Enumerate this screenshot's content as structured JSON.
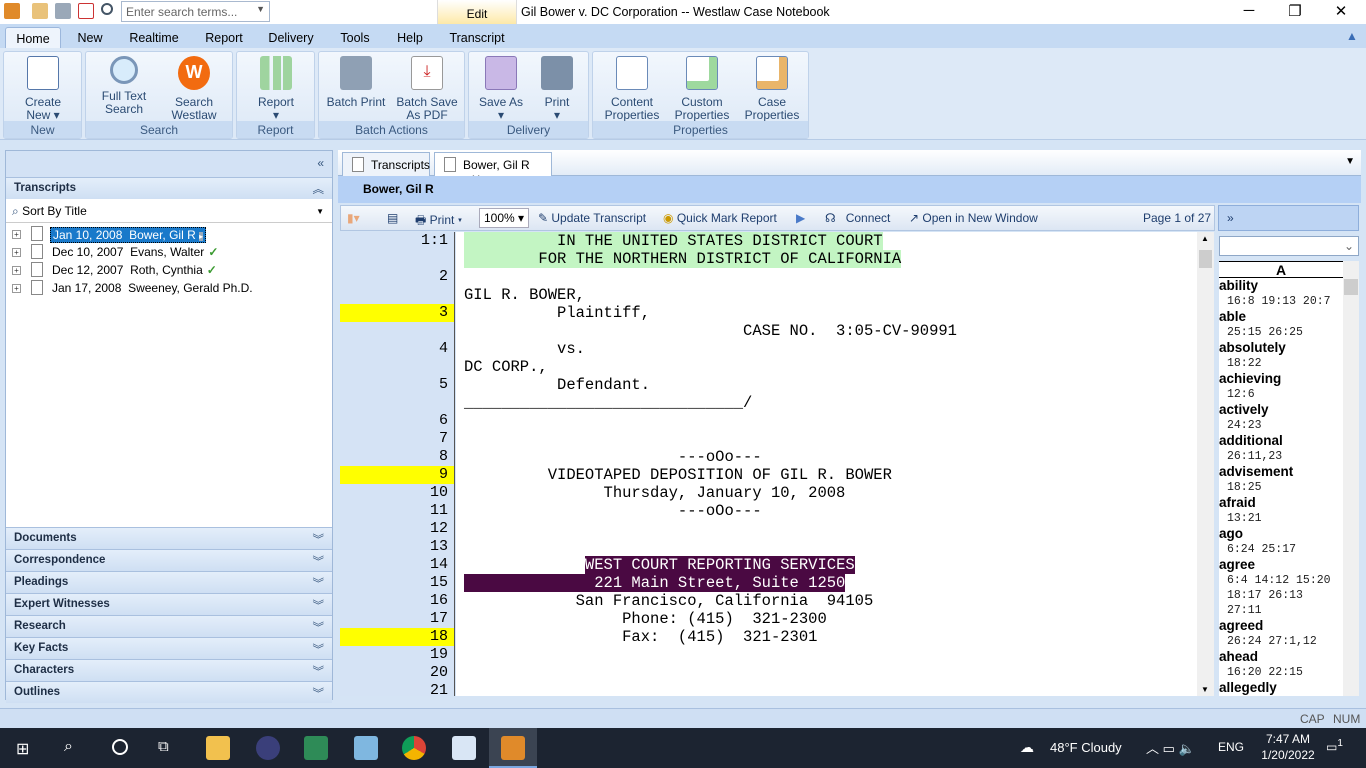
{
  "app": {
    "title": "Gil Bower v. DC Corporation -- Westlaw Case Notebook",
    "search_placeholder": "Enter search terms...",
    "context_tab": "Edit"
  },
  "ribbon_tabs": [
    "Home",
    "New",
    "Realtime",
    "Report",
    "Delivery",
    "Tools",
    "Help",
    "Transcript"
  ],
  "ribbon_groups": [
    {
      "label": "New",
      "buttons": [
        "Create New"
      ]
    },
    {
      "label": "Search",
      "buttons": [
        "Full Text Search",
        "Search Westlaw"
      ]
    },
    {
      "label": "Report",
      "buttons": [
        "Report"
      ]
    },
    {
      "label": "Batch Actions",
      "buttons": [
        "Batch Print",
        "Batch Save As PDF"
      ]
    },
    {
      "label": "Delivery",
      "buttons": [
        "Save As",
        "Print"
      ]
    },
    {
      "label": "Properties",
      "buttons": [
        "Content Properties",
        "Custom Properties",
        "Case Properties"
      ]
    }
  ],
  "left": {
    "section": "Transcripts",
    "sort": "Sort By Title",
    "items": [
      {
        "date": "Jan 10, 2008",
        "name": "Bower, Gil R",
        "checked": false
      },
      {
        "date": "Dec 10, 2007",
        "name": "Evans, Walter",
        "checked": true
      },
      {
        "date": "Dec 12, 2007",
        "name": "Roth, Cynthia",
        "checked": true
      },
      {
        "date": "Jan 17, 2008",
        "name": "Sweeney, Gerald Ph.D.",
        "checked": false
      }
    ],
    "sections": [
      "Documents",
      "Correspondence",
      "Pleadings",
      "Expert Witnesses",
      "Research",
      "Key Facts",
      "Characters",
      "Outlines"
    ]
  },
  "doc_tabs": [
    "Transcripts",
    "Bower, Gil R"
  ],
  "doc_name": "Bower, Gil R",
  "toolbar": {
    "print": "Print",
    "zoom": "100%",
    "update": "Update Transcript",
    "quickmark": "Quick Mark Report",
    "connect": "Connect",
    "open_new": "Open in New Window",
    "page": "Page 1 of 27"
  },
  "transcript": [
    {
      "n": "1:1",
      "t": "          IN THE UNITED STATES DISTRICT COURT",
      "h": "g"
    },
    {
      "n": "",
      "t": "        FOR THE NORTHERN DISTRICT OF CALIFORNIA",
      "h": "g"
    },
    {
      "n": "2",
      "t": ""
    },
    {
      "n": "",
      "t": "GIL R. BOWER,"
    },
    {
      "n": "3",
      "t": "          Plaintiff,",
      "y": true
    },
    {
      "n": "",
      "t": "                              CASE NO.  3:05-CV-90991"
    },
    {
      "n": "4",
      "t": "          vs."
    },
    {
      "n": "",
      "t": "DC CORP.,"
    },
    {
      "n": "5",
      "t": "          Defendant."
    },
    {
      "n": "",
      "t": "______________________________/"
    },
    {
      "n": "6",
      "t": ""
    },
    {
      "n": "7",
      "t": ""
    },
    {
      "n": "8",
      "t": "                       ---oOo---"
    },
    {
      "n": "9",
      "t": "         VIDEOTAPED DEPOSITION OF GIL R. BOWER",
      "y": true
    },
    {
      "n": "10",
      "t": "               Thursday, January 10, 2008"
    },
    {
      "n": "11",
      "t": "                       ---oOo---"
    },
    {
      "n": "12",
      "t": ""
    },
    {
      "n": "13",
      "t": ""
    },
    {
      "n": "14",
      "pre": "             ",
      "t": "WEST COURT REPORTING SERVICES",
      "h": "p"
    },
    {
      "n": "15",
      "t": "              221 Main Street, Suite 1250",
      "h": "p"
    },
    {
      "n": "16",
      "t": "            San Francisco, California  94105"
    },
    {
      "n": "17",
      "t": "                 Phone: (415)  321-2300"
    },
    {
      "n": "18",
      "t": "                 Fax:  (415)  321-2301",
      "y": true
    },
    {
      "n": "19",
      "t": ""
    },
    {
      "n": "20",
      "t": ""
    },
    {
      "n": "21",
      "t": ""
    }
  ],
  "index": {
    "letter": "A",
    "entries": [
      {
        "w": "ability",
        "r": [
          "16:8 19:13 20:7"
        ]
      },
      {
        "w": "able",
        "r": [
          "25:15 26:25"
        ]
      },
      {
        "w": "absolutely",
        "r": [
          "18:22"
        ]
      },
      {
        "w": "achieving",
        "r": [
          "12:6"
        ]
      },
      {
        "w": "actively",
        "r": [
          "24:23"
        ]
      },
      {
        "w": "additional",
        "r": [
          "26:11,23"
        ]
      },
      {
        "w": "advisement",
        "r": [
          "18:25"
        ]
      },
      {
        "w": "afraid",
        "r": [
          "13:21"
        ]
      },
      {
        "w": "ago",
        "r": [
          "6:24 25:17"
        ]
      },
      {
        "w": "agree",
        "r": [
          "6:4 14:12 15:20",
          "18:17 26:13",
          "27:11"
        ]
      },
      {
        "w": "agreed",
        "r": [
          "26:24 27:1,12"
        ]
      },
      {
        "w": "ahead",
        "r": [
          "16:20 22:15"
        ]
      },
      {
        "w": "allegedly",
        "r": []
      }
    ]
  },
  "status": {
    "cap": "CAP",
    "num": "NUM"
  },
  "taskbar": {
    "weather": "48°F  Cloudy",
    "lang": "ENG",
    "time": "7:47 AM",
    "date": "1/20/2022",
    "notif": "1"
  }
}
